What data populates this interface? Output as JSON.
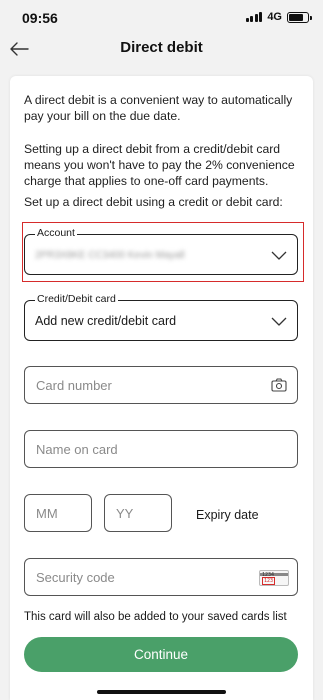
{
  "status_bar": {
    "time": "09:56",
    "network": "4G",
    "icons": [
      "signal-icon",
      "battery-icon"
    ]
  },
  "header": {
    "title": "Direct debit",
    "back_icon": "back-arrow-icon"
  },
  "intro": {
    "paragraph_1": "A direct debit is a convenient way to automatically pay your bill on the due date.",
    "paragraph_2": "Setting up a direct debit from a credit/debit card means you won't have to pay the 2% convenience charge that applies to one-off card payments.",
    "paragraph_3": "Set up a direct debit using a credit or debit card:"
  },
  "account_select": {
    "label": "Account",
    "value": "2PR3X8KE CC3400 Kevin Mayall",
    "highlight_color": "#d62b2b"
  },
  "card_select": {
    "label": "Credit/Debit card",
    "value": "Add new credit/debit card"
  },
  "form": {
    "card_number_placeholder": "Card number",
    "name_placeholder": "Name on card",
    "month_placeholder": "MM",
    "year_placeholder": "YY",
    "expiry_label": "Expiry date",
    "security_code_placeholder": "Security code",
    "cvv_digits": "1234",
    "cvv_highlight": "123"
  },
  "note": "This card will also be added to your saved cards list",
  "continue_button": {
    "label": "Continue",
    "color": "#4aa069"
  }
}
